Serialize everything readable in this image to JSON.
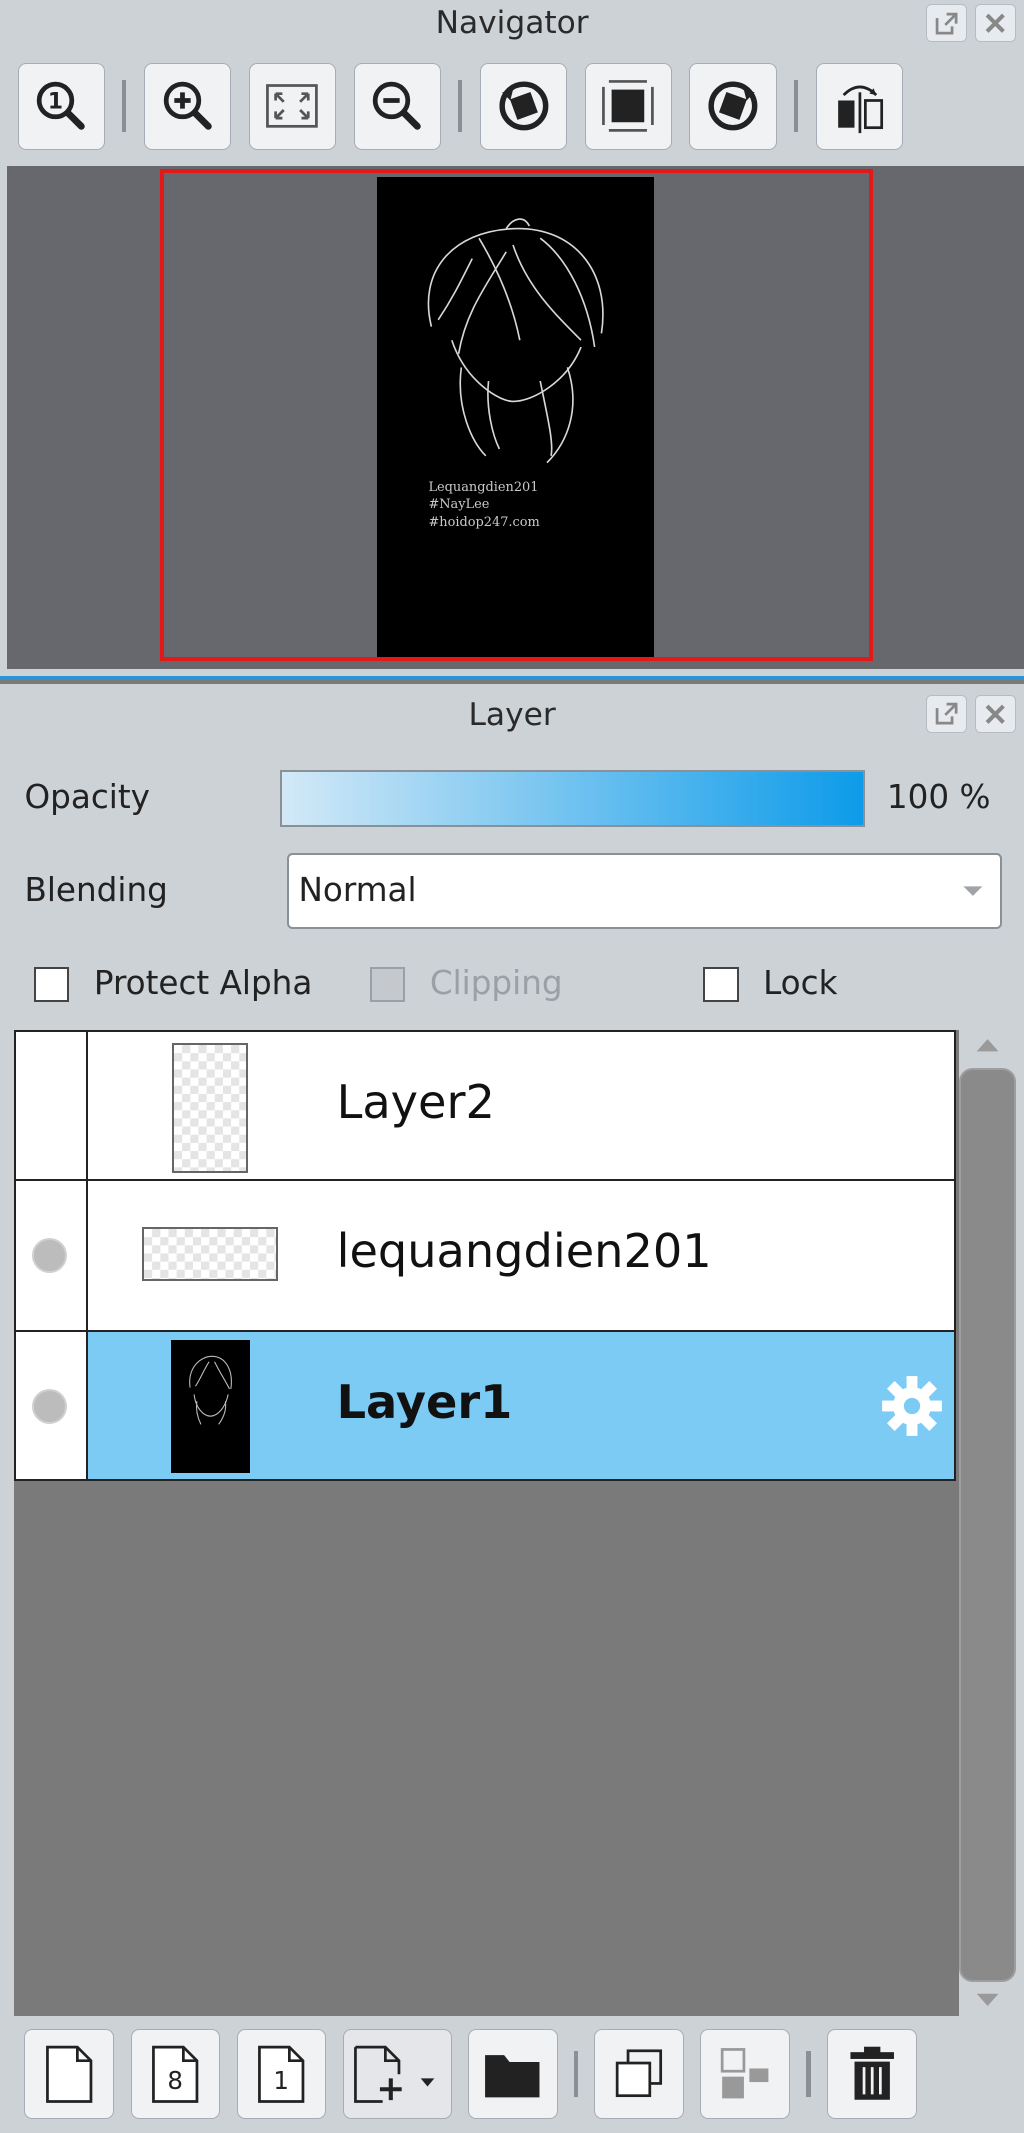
{
  "navigator": {
    "title": "Navigator",
    "toolbar_icons": [
      "zoom-actual-icon",
      "zoom-in-icon",
      "fit-window-icon",
      "zoom-out-icon",
      "rotate-left-icon",
      "rotate-reset-icon",
      "rotate-right-icon",
      "flip-horizontal-icon"
    ],
    "canvas_text": "Lequangdien201\n#NayLee\n#hoidop247.com"
  },
  "layer_panel": {
    "title": "Layer",
    "opacity_label": "Opacity",
    "opacity_value": "100 %",
    "opacity_fraction": 1.0,
    "blending_label": "Blending",
    "blending_value": "Normal",
    "protect_alpha_label": "Protect Alpha",
    "clipping_label": "Clipping",
    "lock_label": "Lock",
    "accent_color": "#7ccbf5",
    "layers": [
      {
        "name": "Layer2",
        "selected": false,
        "visible": false
      },
      {
        "name": "lequangdien201",
        "selected": false,
        "visible": true
      },
      {
        "name": "Layer1",
        "selected": true,
        "visible": true
      }
    ],
    "bottom_icons": [
      "new-layer-icon",
      "new-8bit-layer-icon",
      "new-1bit-layer-icon",
      "add-layer-menu-icon",
      "new-folder-icon",
      "duplicate-layer-icon",
      "merge-down-icon",
      "delete-layer-icon"
    ]
  }
}
